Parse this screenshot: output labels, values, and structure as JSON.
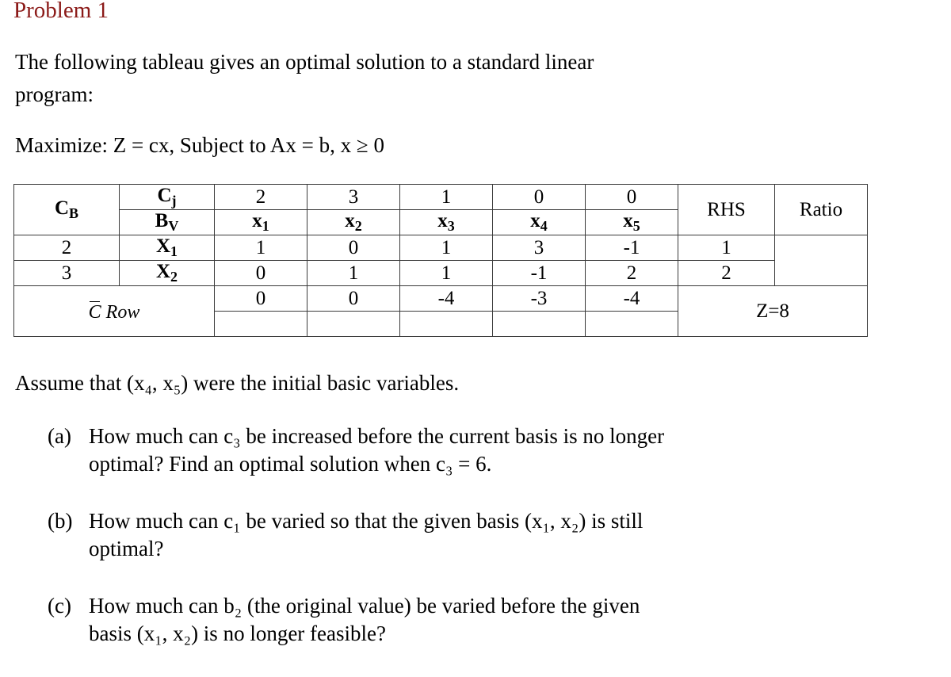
{
  "title": "Problem 1",
  "title_color": "#8B1A18",
  "intro": {
    "line1": "The  following  tableau  gives  an  optimal  solution  to  a  standard  linear",
    "line2": "program:"
  },
  "objective": "Maximize: Z = cx, Subject to Ax = b, x ≥ 0",
  "tableau": {
    "header_cb": "C",
    "header_cb_sub": "B",
    "header_cj": "C",
    "header_cj_sub": "j",
    "header_bv": "B",
    "header_bv_sub": "V",
    "cj_values": [
      "2",
      "3",
      "1",
      "0",
      "0"
    ],
    "variable_headers": [
      {
        "base": "x",
        "sub": "1"
      },
      {
        "base": "x",
        "sub": "2"
      },
      {
        "base": "x",
        "sub": "3"
      },
      {
        "base": "x",
        "sub": "4"
      },
      {
        "base": "x",
        "sub": "5"
      }
    ],
    "rhs_label": "RHS",
    "ratio_label": "Ratio",
    "rows": [
      {
        "cb": "2",
        "bv_base": "X",
        "bv_sub": "1",
        "coeffs": [
          "1",
          "0",
          "1",
          "3",
          "-1"
        ],
        "rhs": "1",
        "ratio": ""
      },
      {
        "cb": "3",
        "bv_base": "X",
        "bv_sub": "2",
        "coeffs": [
          "0",
          "1",
          "1",
          "-1",
          "2"
        ],
        "rhs": "2",
        "ratio": ""
      }
    ],
    "c_row": {
      "label_bar": "C",
      "label_rest": " Row",
      "coeffs": [
        "0",
        "0",
        "-4",
        "-3",
        "-4"
      ],
      "objective_value": "Z=8"
    }
  },
  "assume_text": "Assume that (x₄, x₅) were the initial basic variables.",
  "questions": [
    {
      "marker": "(a)",
      "line1": "How  much  can  c₃  be  increased  before  the  current  basis  is  no  longer",
      "line2": "optimal? Find an optimal solution when c₃ = 6."
    },
    {
      "marker": "(b)",
      "line1": "How  much  can  c₁  be  varied  so  that  the  given  basis  (x₁,  x₂)  is  still",
      "line2": "optimal?"
    },
    {
      "marker": "(c)",
      "line1": "How  much  can  b₂  (the  original  value)  be  varied  before  the  given",
      "line2": "basis (x₁, x₂) is no longer feasible?"
    }
  ]
}
